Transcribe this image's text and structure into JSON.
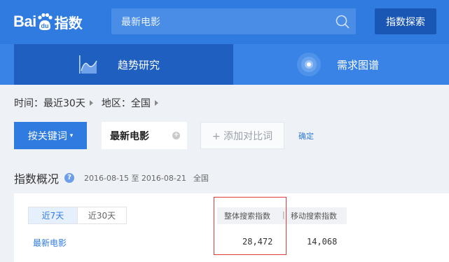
{
  "header": {
    "logo_bai": "Bai",
    "logo_du": "du",
    "logo_product": "指数",
    "search": {
      "value": "最新电影"
    },
    "explore_label": "指数探索"
  },
  "nav": {
    "tabs": [
      {
        "label": "趋势研究",
        "active": true
      },
      {
        "label": "需求图谱",
        "active": false
      }
    ]
  },
  "filters": {
    "time_label": "时间：",
    "time_value": "最近30天",
    "region_label": "地区：",
    "region_value": "全国"
  },
  "keywords": {
    "mode_label": "按关键词",
    "mode_caret": "▾",
    "current": "最新电影",
    "remove_symbol": "+",
    "add_compare": "+ 添加对比词",
    "confirm": "确定"
  },
  "overview": {
    "title": "指数概况",
    "help_symbol": "?",
    "date_range": "2016-08-15 至 2016-08-21",
    "region": "全国",
    "period_tabs": [
      {
        "label": "近7天",
        "active": true
      },
      {
        "label": "近30天",
        "active": false
      }
    ],
    "columns": [
      "整体搜索指数",
      "移动搜索指数"
    ],
    "column_separator": "|",
    "rows": [
      {
        "keyword": "最新电影",
        "overall": "28,472",
        "mobile": "14,068"
      }
    ]
  },
  "colors": {
    "brand_blue": "#2f7be0",
    "nav_active": "#1f5fc0",
    "highlight_red": "#e03a3a"
  }
}
